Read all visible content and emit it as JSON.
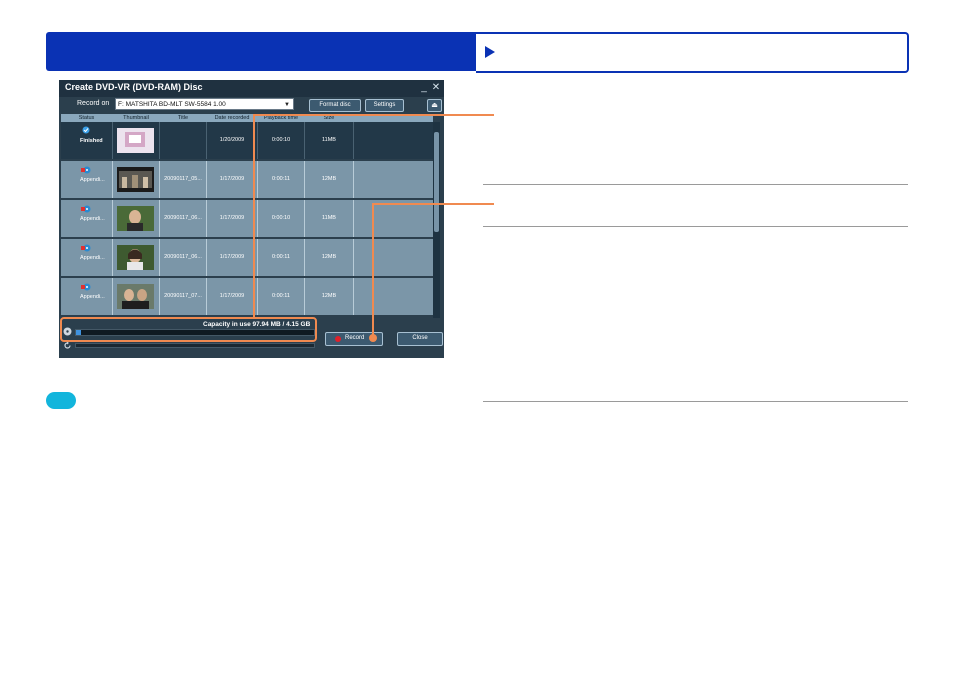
{
  "window": {
    "title": "Create DVD-VR (DVD-RAM) Disc",
    "record_on_label": "Record on",
    "drive": "F: MATSHITA BD-MLT SW-5584 1.00",
    "format_btn": "Format disc",
    "settings_btn": "Settings",
    "columns": [
      "Status",
      "Thumbnail",
      "Title",
      "Date recorded",
      "Playback time",
      "Size"
    ],
    "rows": [
      {
        "status": "Finished",
        "title": "",
        "date": "1/20/2009",
        "time": "0:00:10",
        "size": "11MB"
      },
      {
        "status": "Appendi...",
        "title": "20090117_05...",
        "date": "1/17/2009",
        "time": "0:00:11",
        "size": "12MB"
      },
      {
        "status": "Appendi...",
        "title": "20090117_06...",
        "date": "1/17/2009",
        "time": "0:00:10",
        "size": "11MB"
      },
      {
        "status": "Appendi...",
        "title": "20090117_06...",
        "date": "1/17/2009",
        "time": "0:00:11",
        "size": "12MB"
      },
      {
        "status": "Appendi...",
        "title": "20090117_07...",
        "date": "1/17/2009",
        "time": "0:00:11",
        "size": "12MB"
      }
    ],
    "capacity_label": "Capacity in use",
    "capacity_value": "97.94 MB / 4.15 GB",
    "capacity_fraction": 0.023,
    "record_btn": "Record",
    "close_btn": "Close"
  },
  "colors": {
    "header_blue": "#0a32b4",
    "callout": "#f08a50",
    "info_pill": "#12b5dc"
  }
}
